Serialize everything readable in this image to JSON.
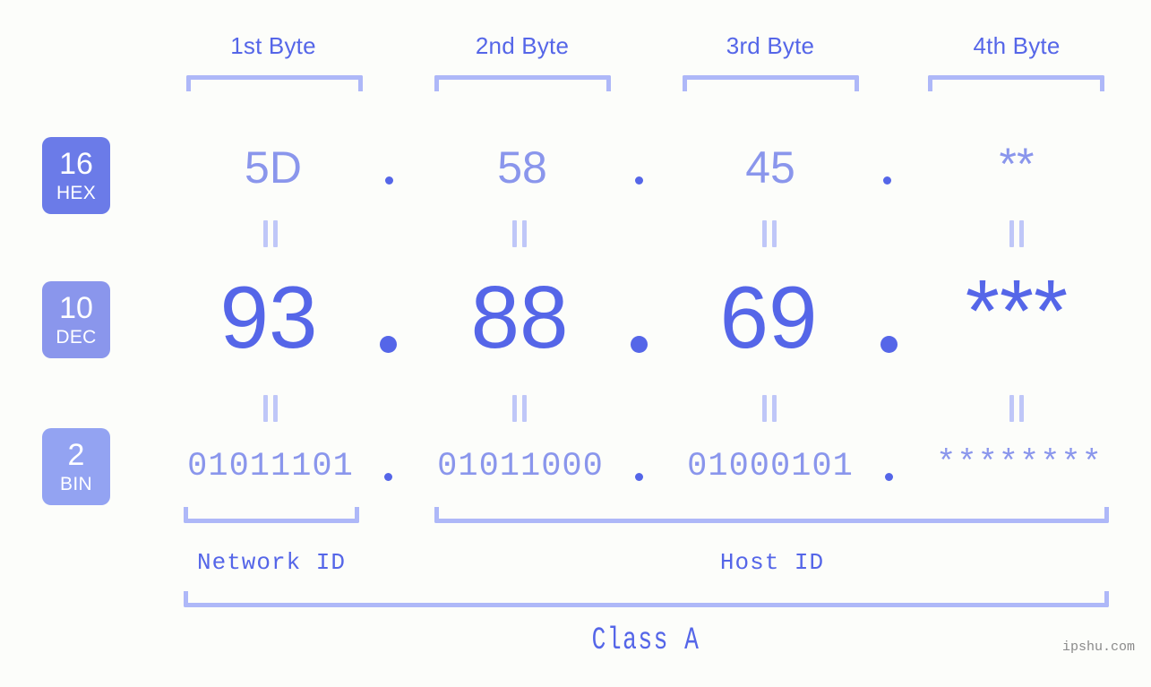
{
  "meta": {
    "background_color": "#FCFDFA",
    "accent_strong": "#5566E8",
    "accent_light": "#8A96EC",
    "bracket_color": "#AEB8F8"
  },
  "byte_headers": [
    {
      "label": "1st Byte"
    },
    {
      "label": "2nd Byte"
    },
    {
      "label": "3rd Byte"
    },
    {
      "label": "4th Byte"
    }
  ],
  "rows": [
    {
      "key": "hex",
      "badge": {
        "number": "16",
        "name": "HEX",
        "color": "#6B7BE8"
      },
      "values": [
        "5D",
        "58",
        "45",
        "**"
      ],
      "separator": "."
    },
    {
      "key": "dec",
      "badge": {
        "number": "10",
        "name": "DEC",
        "color": "#8A96EC"
      },
      "values": [
        "93",
        "88",
        "69",
        "***"
      ],
      "separator": "."
    },
    {
      "key": "bin",
      "badge": {
        "number": "2",
        "name": "BIN",
        "color": "#93A3F2"
      },
      "values": [
        "01011101",
        "01011000",
        "01000101",
        "********"
      ],
      "separator": "."
    }
  ],
  "equals_marks": {
    "symbol": "=",
    "count_per_gap": 4
  },
  "id_labels": [
    {
      "label": "Network ID"
    },
    {
      "label": "Host ID"
    }
  ],
  "class_label": "Class A",
  "watermark": "ipshu.com"
}
